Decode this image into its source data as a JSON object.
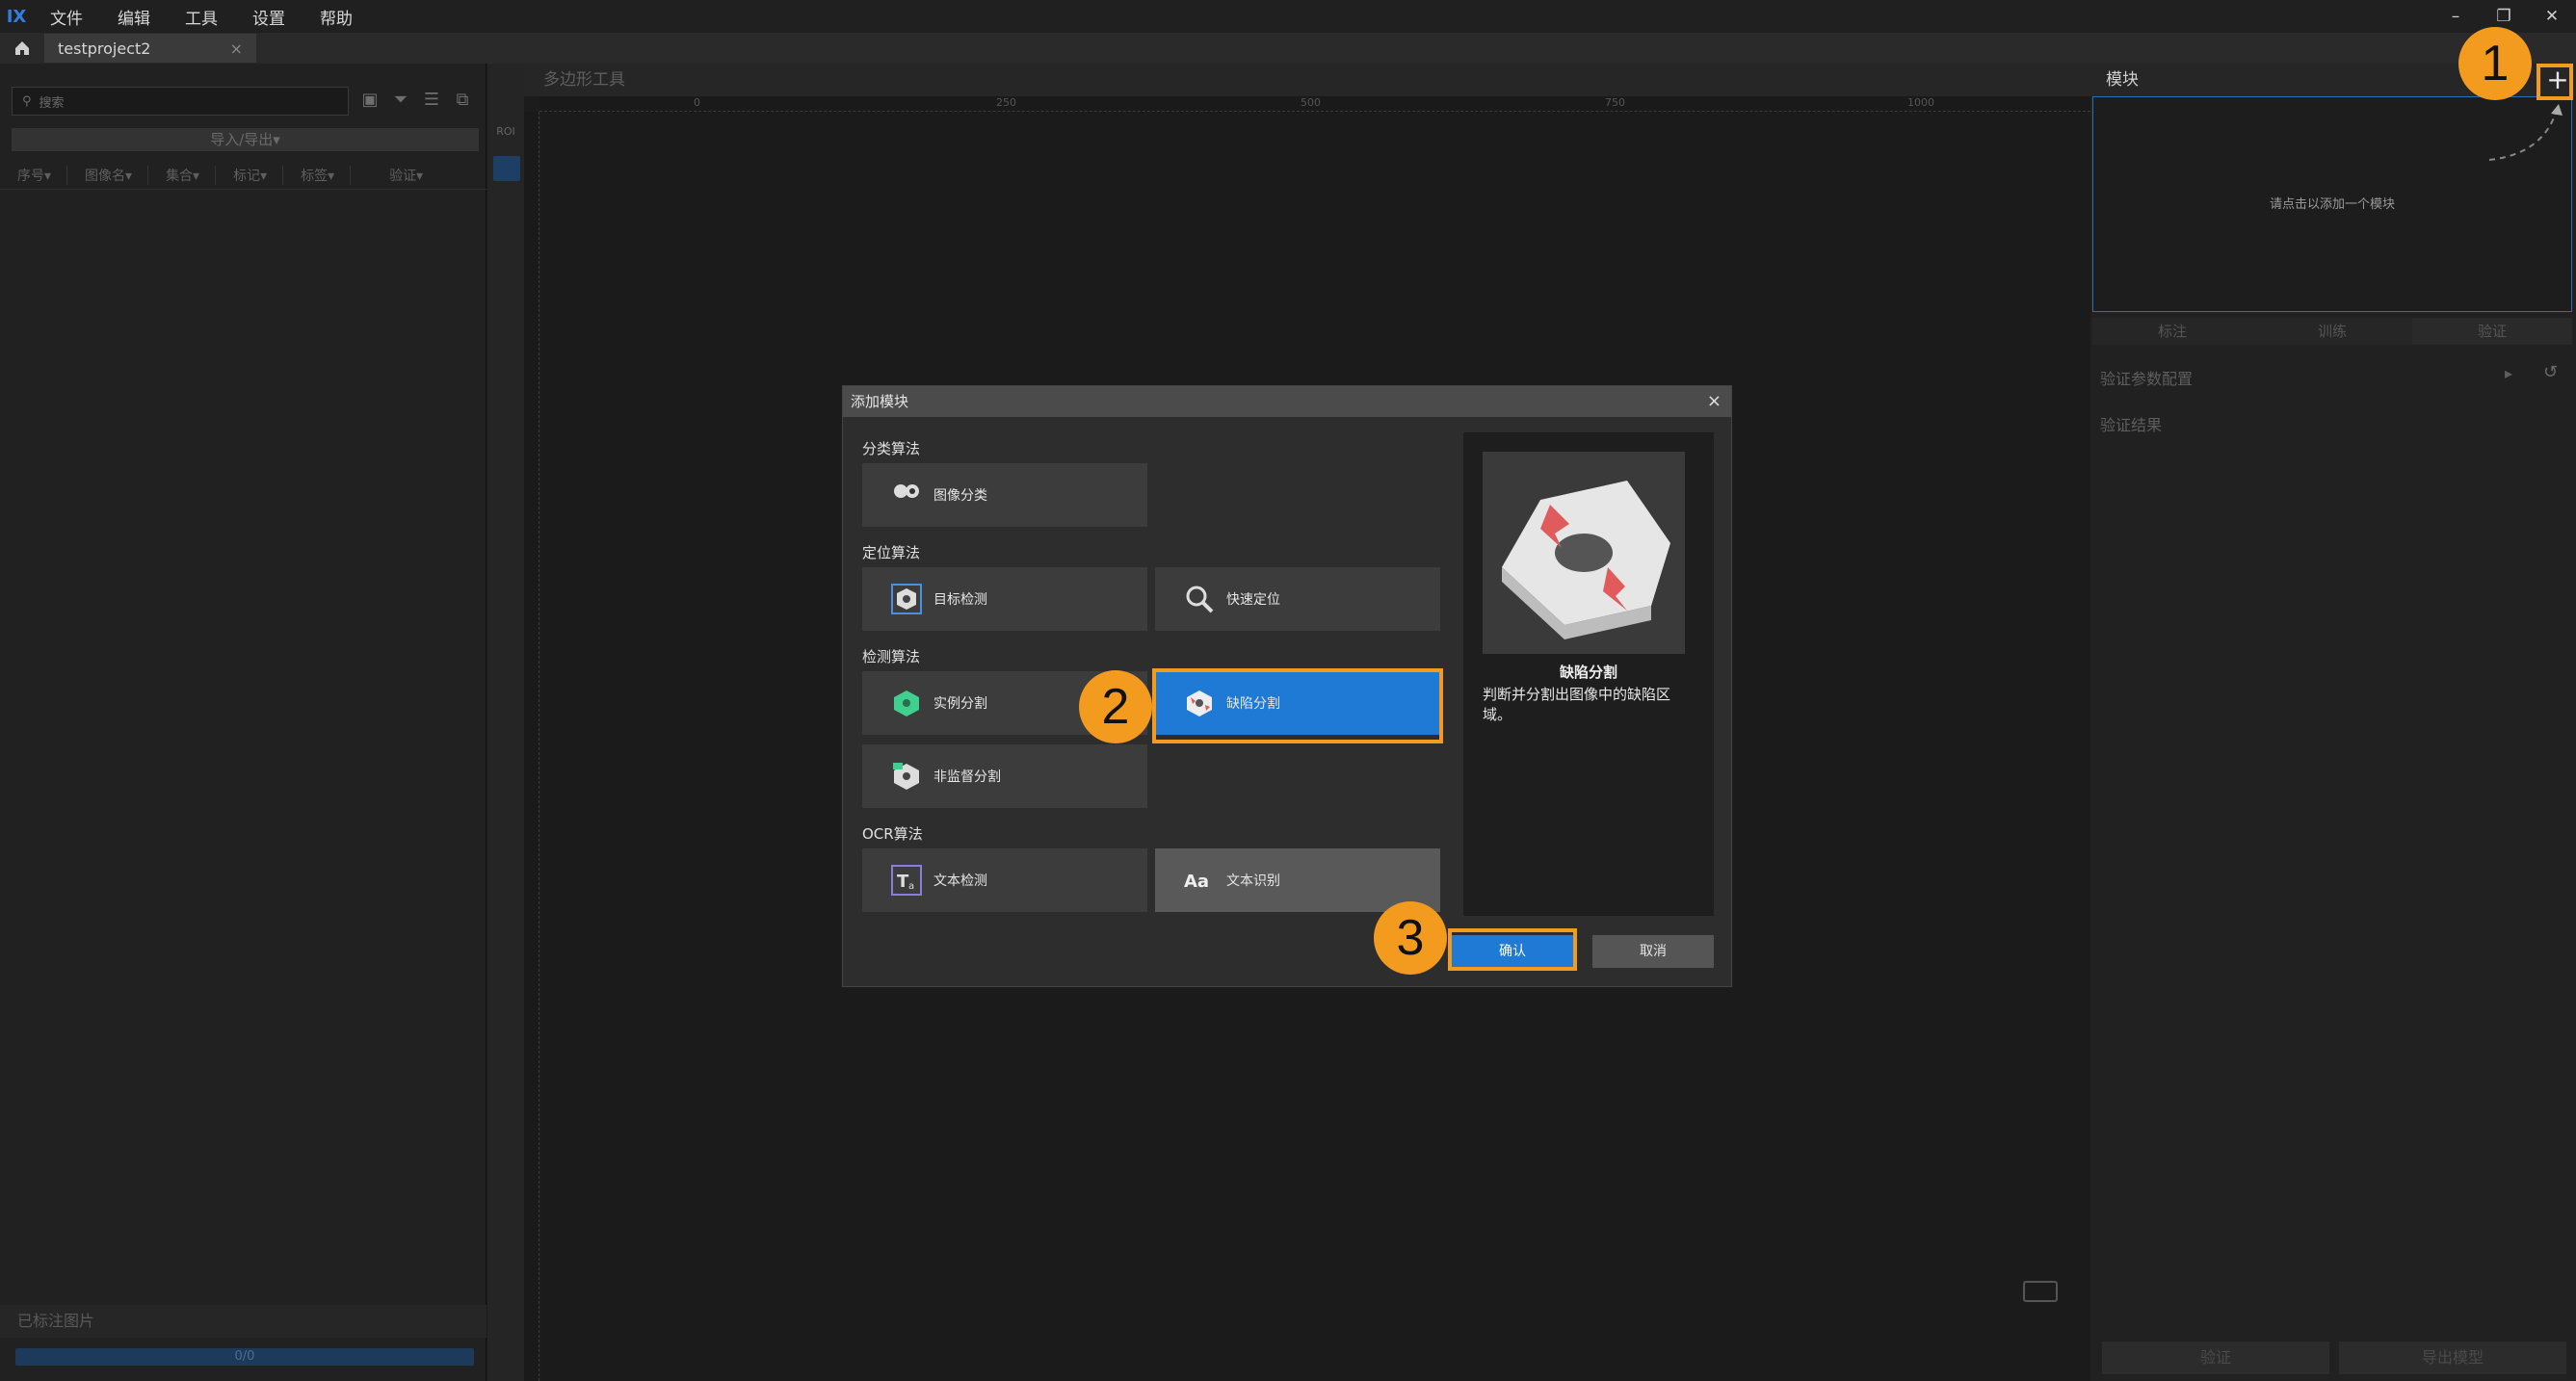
{
  "app": {
    "logo": "IX",
    "menu": [
      "文件",
      "编辑",
      "工具",
      "设置",
      "帮助"
    ]
  },
  "tabs": {
    "project": "testproject2",
    "close": "×"
  },
  "left": {
    "search_placeholder": "搜索",
    "import_export": "导入/导出▾",
    "columns": [
      "序号▾",
      "图像名▾",
      "集合▾",
      "标记▾",
      "标签▾",
      "验证▾"
    ],
    "labeled": "已标注图片",
    "progress": "0/0"
  },
  "tools": {
    "roi": "ROI"
  },
  "canvas": {
    "header": "多边形工具",
    "ruler_h": [
      "0",
      "250",
      "500",
      "750",
      "1000"
    ]
  },
  "right": {
    "header": "模块",
    "empty_hint": "请点击以添加一个模块",
    "tabs": [
      "标注",
      "训练",
      "验证"
    ],
    "verif_config": "验证参数配置",
    "verif_result": "验证结果",
    "verify_btn": "验证",
    "export_btn": "导出模型"
  },
  "dialog": {
    "title": "添加模块",
    "close": "×",
    "categories": [
      "分类算法",
      "定位算法",
      "检测算法",
      "OCR算法"
    ],
    "algos": {
      "img_class": "图像分类",
      "obj_detect": "目标检测",
      "fast_locate": "快速定位",
      "inst_seg": "实例分割",
      "defect_seg": "缺陷分割",
      "unsup_seg": "非监督分割",
      "text_detect": "文本检测",
      "text_recog": "文本识别"
    },
    "preview": {
      "title": "缺陷分割",
      "desc": "判断并分割出图像中的缺陷区域。"
    },
    "ok": "确认",
    "cancel": "取消"
  },
  "callouts": [
    "1",
    "2",
    "3"
  ],
  "colors": {
    "accent": "#1f7ad6",
    "callout": "#f29b1e"
  }
}
